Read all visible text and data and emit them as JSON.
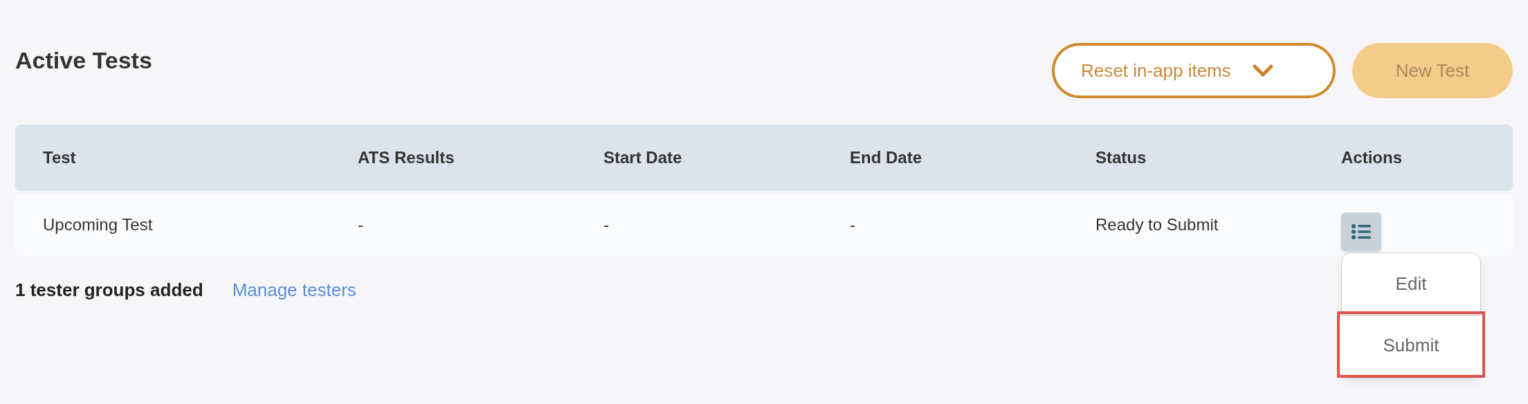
{
  "title": "Active Tests",
  "buttons": [
    {
      "label": "Reset in-app items",
      "kind": "dropdown",
      "disabled": false
    },
    {
      "label": "New Test",
      "kind": "primary",
      "disabled": true
    }
  ],
  "table": {
    "columns": [
      "Test",
      "ATS Results",
      "Start Date",
      "End Date",
      "Status",
      "Actions"
    ],
    "rows": [
      {
        "cells": [
          "Upcoming Test",
          "-",
          "-",
          "-",
          "Ready to Submit"
        ],
        "actions_open": true
      }
    ]
  },
  "actions_menu": {
    "items": [
      {
        "label": "Edit",
        "highlighted": false
      },
      {
        "label": "Submit",
        "highlighted": true
      }
    ]
  },
  "footer": {
    "summary": "1 tester groups added",
    "link": "Manage testers"
  }
}
